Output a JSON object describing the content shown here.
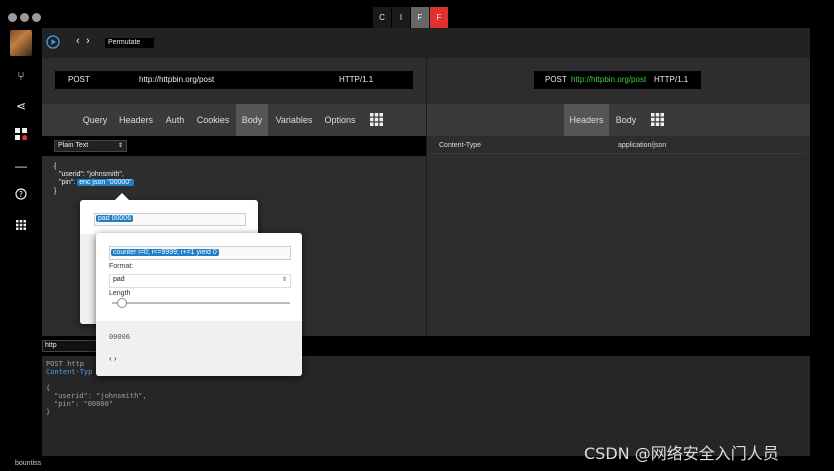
{
  "window": {
    "tabs": [
      "C",
      "I",
      "F",
      "F"
    ]
  },
  "toolbar": {
    "nav_back": "‹",
    "nav_fwd": "›",
    "label": "Permutate"
  },
  "request": {
    "method": "POST",
    "url": "http://httpbin.org/post",
    "protocol": "HTTP/1.1"
  },
  "response_line": {
    "method": "POST",
    "url": "http://httpbin.org/post",
    "protocol": "HTTP/1.1"
  },
  "req_tabs": [
    "Query",
    "Headers",
    "Auth",
    "Cookies",
    "Body",
    "Variables",
    "Options"
  ],
  "resp_tabs": [
    "Headers",
    "Body"
  ],
  "body_format": "Plain Text",
  "body": {
    "open": "{",
    "line1": "\"userid\": \"johnsmith\",",
    "line2_prefix": "\"pin\": ",
    "line2_token": "enc json \"00000\"",
    "close": "}"
  },
  "headers_table": {
    "name": "Content-Type",
    "value": "application/json"
  },
  "popup1": {
    "token": "pad 00006"
  },
  "popup2": {
    "token": "counter i=0; i<=9999; i+=1 yield 0",
    "format_label": "Format:",
    "format_value": "pad",
    "length_label": "Length",
    "slider_value": 0.05,
    "preview": "00006",
    "nav": "‹ ›"
  },
  "bottom_input": "http",
  "raw": {
    "line1": "POST http",
    "line2": "Content-Typ",
    "line3": "{",
    "line4": "\"userid\": \"johnsmith\",",
    "line5": "\"pin\": \"00000\"",
    "line6": "}"
  },
  "status_left": "bountiss",
  "watermark": "CSDN @网络安全入门人员",
  "colors": {
    "accent": "#1e7fc8",
    "tab_active": "#e03030",
    "url_green": "#3ccf3c"
  }
}
